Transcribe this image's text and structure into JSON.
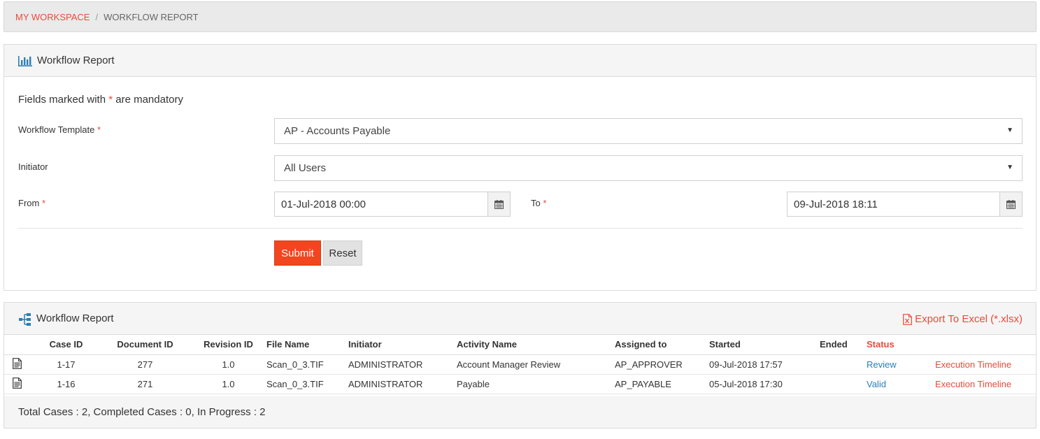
{
  "breadcrumb": {
    "root": "MY WORKSPACE",
    "separator": "/",
    "current": "WORKFLOW REPORT"
  },
  "filter_panel": {
    "title": "Workflow Report",
    "mandatory_note_prefix": "Fields marked with",
    "mandatory_star": "*",
    "mandatory_note_suffix": "are mandatory",
    "workflow_template_label": "Workflow Template",
    "workflow_template_value": "AP - Accounts Payable",
    "initiator_label": "Initiator",
    "initiator_value": "All Users",
    "from_label": "From",
    "from_value": "01-Jul-2018 00:00",
    "to_label": "To",
    "to_value": "09-Jul-2018 18:11",
    "submit_label": "Submit",
    "reset_label": "Reset"
  },
  "report_panel": {
    "title": "Workflow Report",
    "export_label": "Export To Excel (*.xlsx)",
    "columns": [
      "Case ID",
      "Document ID",
      "Revision ID",
      "File Name",
      "Initiator",
      "Activity Name",
      "Assigned to",
      "Started",
      "Ended",
      "Status"
    ],
    "rows": [
      {
        "case_id": "1-17",
        "document_id": "277",
        "revision_id": "1.0",
        "file_name": "Scan_0_3.TIF",
        "initiator": "ADMINISTRATOR",
        "activity": "Account Manager Review",
        "assigned_to": "AP_APPROVER",
        "started": "09-Jul-2018 17:57",
        "ended": "",
        "status": "Review",
        "timeline": "Execution Timeline"
      },
      {
        "case_id": "1-16",
        "document_id": "271",
        "revision_id": "1.0",
        "file_name": "Scan_0_3.TIF",
        "initiator": "ADMINISTRATOR",
        "activity": "Payable",
        "assigned_to": "AP_PAYABLE",
        "started": "05-Jul-2018 17:30",
        "ended": "",
        "status": "Valid",
        "timeline": "Execution Timeline"
      }
    ],
    "totals": "Total Cases : 2, Completed Cases : 0, In Progress : 2"
  },
  "icons": {
    "report": "bar-chart-icon",
    "tree": "sitemap-icon",
    "excel": "excel-file-icon",
    "calendar": "calendar-icon",
    "document": "document-icon",
    "caret": "caret-down-icon"
  },
  "colors": {
    "accent": "#e74c3c",
    "submit": "#f1461f",
    "link": "#2a7fb8",
    "header_bg": "#f5f5f5"
  }
}
